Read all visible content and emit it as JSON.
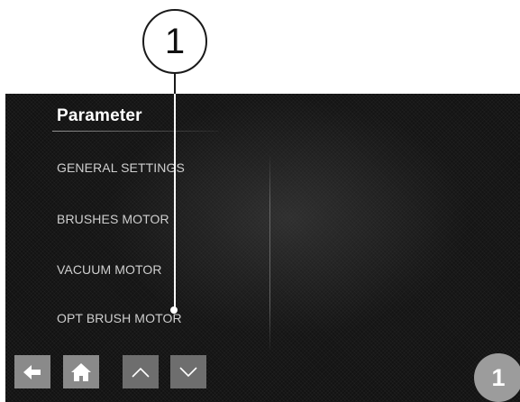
{
  "callout": {
    "number": "1"
  },
  "screen": {
    "title": "Parameter",
    "menu_items": [
      {
        "label": "GENERAL SETTINGS"
      },
      {
        "label": "BRUSHES MOTOR"
      },
      {
        "label": "VACUUM MOTOR"
      },
      {
        "label": "OPT BRUSH MOTOR"
      }
    ]
  },
  "nav_bar": {
    "buttons": [
      {
        "icon": "back-arrow-icon"
      },
      {
        "icon": "home-icon"
      },
      {
        "icon": "chevron-up-icon"
      },
      {
        "icon": "chevron-down-icon"
      }
    ]
  },
  "step_badge": {
    "number": "1"
  },
  "colors": {
    "screen_background": "#121212",
    "menu_text": "#cfcfcf",
    "button_gray": "#8a8a8a",
    "badge_gray": "#9c9c9c"
  }
}
